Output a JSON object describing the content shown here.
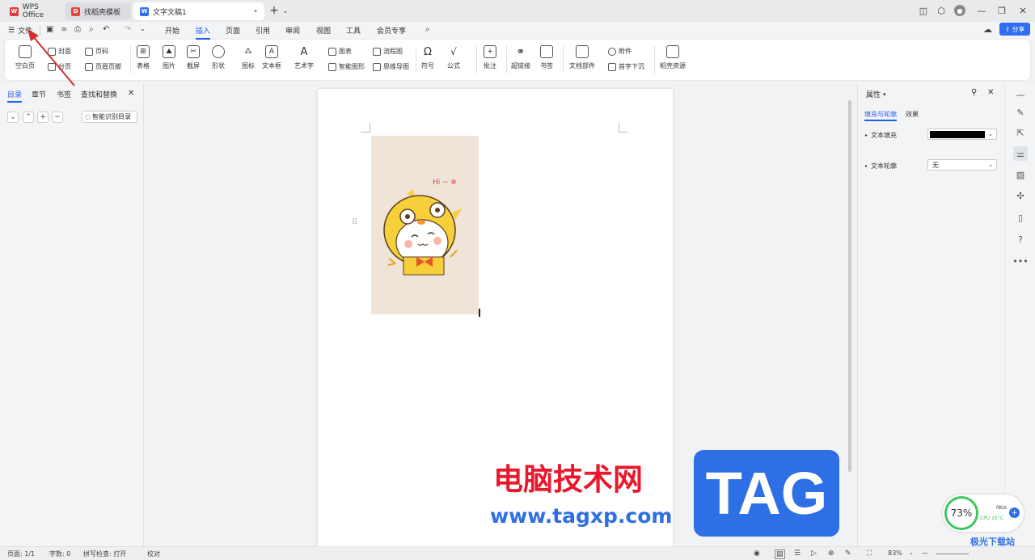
{
  "titlebar": {
    "tabs": [
      {
        "label": "WPS Office",
        "logo": "W"
      },
      {
        "label": "找稻壳模板",
        "logo": "D"
      },
      {
        "label": "文字文稿1",
        "logo": "W"
      }
    ],
    "new_tab": "+"
  },
  "menubar": {
    "file_label": "文件",
    "items": [
      "开始",
      "插入",
      "页面",
      "引用",
      "审阅",
      "视图",
      "工具",
      "会员专享"
    ],
    "active_index": 1,
    "share_label": "分享"
  },
  "ribbon": {
    "blank_page": "空白页",
    "cover": "封面",
    "page_break": "分页",
    "page_number": "页码",
    "header_footer": "页眉页脚",
    "table": "表格",
    "picture": "图片",
    "screenshot": "截屏",
    "shape": "形状",
    "icon": "图标",
    "textbox": "文本框",
    "wordart": "艺术字",
    "chart": "图表",
    "smart_shape": "智能图形",
    "flowchart": "流程图",
    "mindmap": "思维导图",
    "symbol": "符号",
    "formula": "公式",
    "comment": "批注",
    "hyperlink": "超链接",
    "bookmark": "书签",
    "doc_parts": "文档部件",
    "attachment": "附件",
    "drop_cap": "首字下沉",
    "docer_resources": "稻壳资源"
  },
  "leftpanel": {
    "tabs": [
      "目录",
      "章节",
      "书签",
      "查找和替换"
    ],
    "smart_toc": "智能识别目录"
  },
  "document": {
    "image_text": "Hi ~"
  },
  "rightpanel": {
    "title": "属性",
    "tabs": [
      "填充与轮廓",
      "效果"
    ],
    "text_fill_label": "文本填充",
    "text_fill_color": "#000000",
    "text_outline_label": "文本轮廓",
    "text_outline_value": "无"
  },
  "statusbar": {
    "page": "页面: 1/1",
    "words": "字数: 0",
    "spellcheck": "拼写检查: 打开",
    "proofread": "校对",
    "zoom": "83%"
  },
  "overlay": {
    "cpu_percent": "73%",
    "net_speed": "0K/s",
    "cpu_temp": "CPU 25°C",
    "watermark_cn": "电脑技术网",
    "watermark_url": "www.tagxp.com",
    "watermark_logo": "TAG",
    "site_badge": "极光下载站"
  },
  "colors": {
    "accent": "#1e5ef5",
    "arrow": "#d32f2f",
    "watermark_red": "#e8192c",
    "watermark_blue": "#2e6fe6"
  }
}
